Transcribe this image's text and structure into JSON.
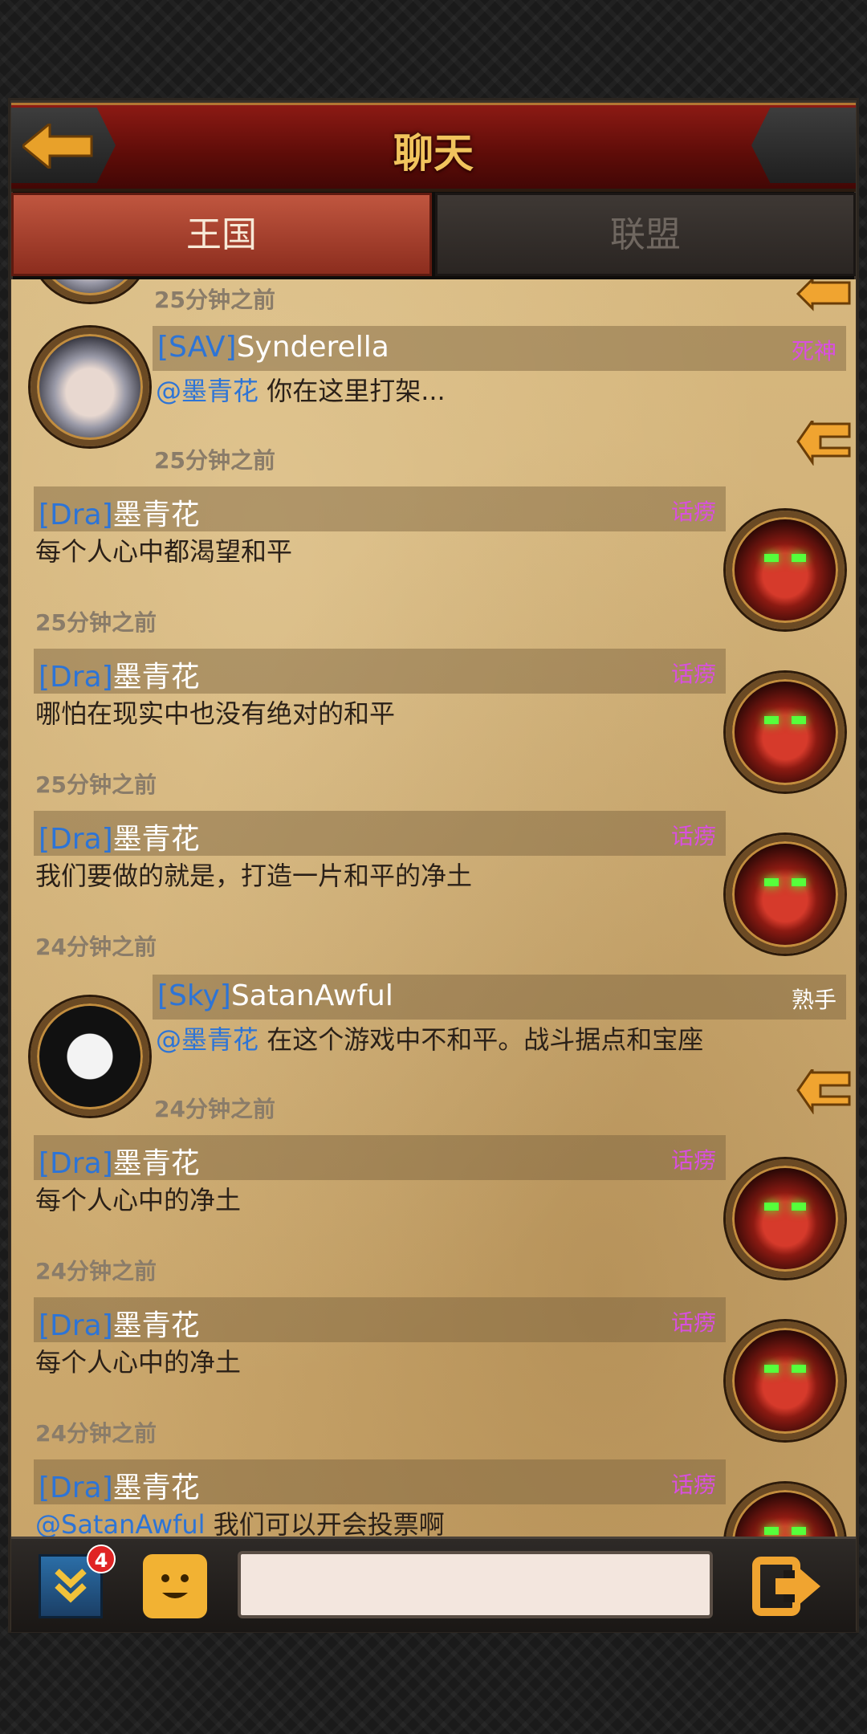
{
  "header": {
    "title": "聊天"
  },
  "tabs": [
    {
      "label": "王国",
      "active": true
    },
    {
      "label": "联盟",
      "active": false
    }
  ],
  "messages": [
    {
      "time": "25分钟之前"
    },
    {
      "side": "left",
      "avatar": "girl-portrait",
      "tag": "[SAV]",
      "name": "Synderella",
      "title": "死神",
      "title_color": "#d94fe0",
      "mention": "@墨青花",
      "text": "你在这里打架...",
      "time": "25分钟之前"
    },
    {
      "side": "right",
      "avatar": "demon-portrait",
      "tag": "[Dra]",
      "name": "墨青花",
      "title": "话痨",
      "title_color": "#d94fe0",
      "text": "每个人心中都渴望和平",
      "time": "25分钟之前"
    },
    {
      "side": "right",
      "avatar": "demon-portrait",
      "tag": "[Dra]",
      "name": "墨青花",
      "title": "话痨",
      "title_color": "#d94fe0",
      "text": "哪怕在现实中也没有绝对的和平",
      "time": "25分钟之前"
    },
    {
      "side": "right",
      "avatar": "demon-portrait",
      "tag": "[Dra]",
      "name": "墨青花",
      "title": "话痨",
      "title_color": "#d94fe0",
      "text": "我们要做的就是，打造一片和平的净土",
      "time": "24分钟之前"
    },
    {
      "side": "left",
      "avatar": "skull-portrait",
      "tag": "[Sky]",
      "name": "SatanAwful",
      "title": "熟手",
      "title_color": "#ffffff",
      "mention": "@墨青花",
      "text": "在这个游戏中不和平。战斗据点和宝座",
      "time": "24分钟之前"
    },
    {
      "side": "right",
      "avatar": "demon-portrait",
      "tag": "[Dra]",
      "name": "墨青花",
      "title": "话痨",
      "title_color": "#d94fe0",
      "text": "每个人心中的净土",
      "time": "24分钟之前"
    },
    {
      "side": "right",
      "avatar": "demon-portrait",
      "tag": "[Dra]",
      "name": "墨青花",
      "title": "话痨",
      "title_color": "#d94fe0",
      "text": "每个人心中的净土",
      "time": "24分钟之前"
    },
    {
      "side": "right",
      "avatar": "demon-portrait",
      "tag": "[Dra]",
      "name": "墨青花",
      "title": "话痨",
      "title_color": "#d94fe0",
      "mention": "@SatanAwful",
      "text": "我们可以开会投票啊"
    }
  ],
  "bottom": {
    "badge_count": "4",
    "input_value": "",
    "icons": [
      "collapse-chevron-icon",
      "emoji-icon",
      "send-icon"
    ]
  },
  "colors": {
    "accent": "#f1c45d",
    "tag": "#2d74d6",
    "header": "#8c1a14",
    "parchment": "#d6b77e"
  }
}
